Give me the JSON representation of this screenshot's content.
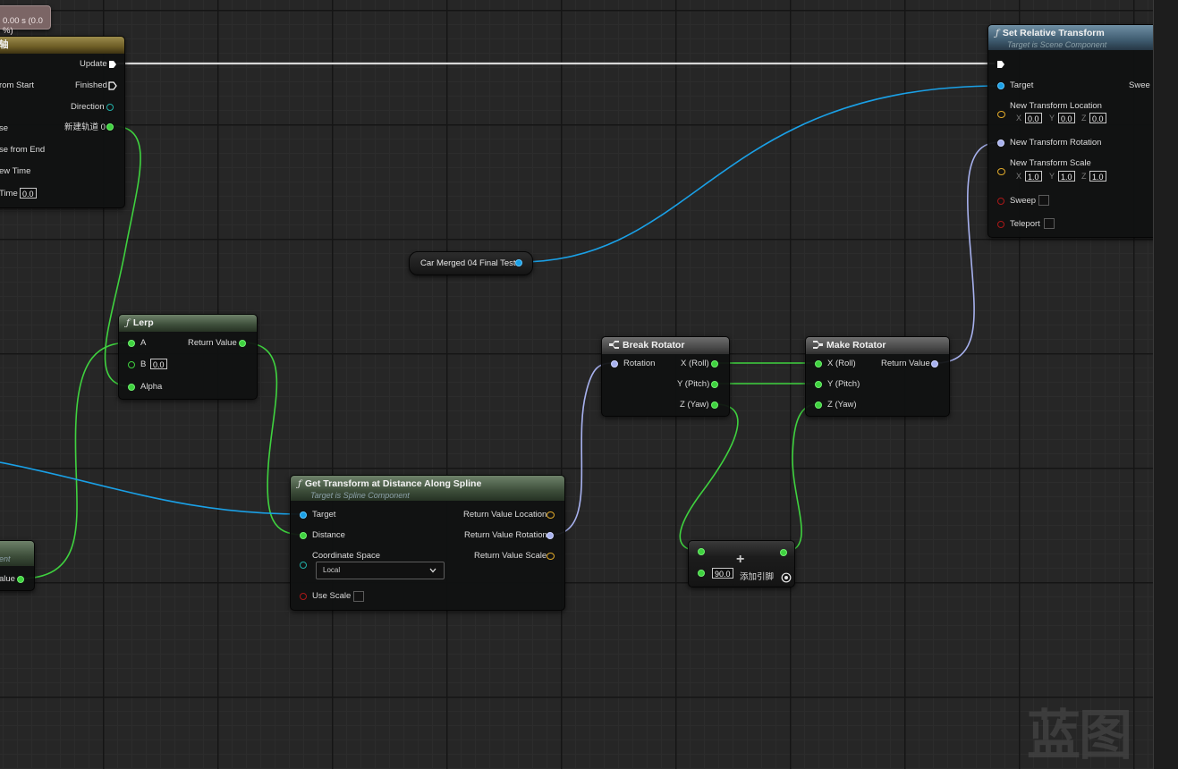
{
  "timeline": {
    "badge": "0.00 s (0.0 %)",
    "header_title": "轴",
    "out_update": "Update",
    "out_finished": "Finished",
    "out_direction": "Direction",
    "out_track": "新建轨道 0",
    "in_play_from_start": "rom Start",
    "in_reverse": "se",
    "in_reverse_from_end": "se from End",
    "in_set_new_time": "ew Time",
    "in_new_time": "Time",
    "new_time_value": "0.0"
  },
  "spline_fragment": {
    "subtitle": "ent",
    "out_return": "alue"
  },
  "lerp": {
    "title": "Lerp",
    "in_a": "A",
    "in_b": "B",
    "b_value": "0.0",
    "in_alpha": "Alpha",
    "out_return": "Return Value"
  },
  "get_transform": {
    "title": "Get Transform at Distance Along Spline",
    "subtitle": "Target is Spline Component",
    "in_target": "Target",
    "in_distance": "Distance",
    "in_coord_space": "Coordinate Space",
    "coord_space_value": "Local",
    "in_use_scale": "Use Scale",
    "out_location": "Return Value Location",
    "out_rotation": "Return Value Rotation",
    "out_scale": "Return Value Scale"
  },
  "car_variable": {
    "label": "Car Merged 04 Final Test"
  },
  "set_relative_transform": {
    "title": "Set Relative Transform",
    "subtitle": "Target is Scene Component",
    "in_target": "Target",
    "out_sweep_hit": "Swee",
    "in_location": "New Transform Location",
    "loc_x": "0.0",
    "loc_y": "0.0",
    "loc_z": "0.0",
    "in_rotation": "New Transform Rotation",
    "in_scale": "New Transform Scale",
    "scale_x": "1.0",
    "scale_y": "1.0",
    "scale_z": "1.0",
    "in_sweep": "Sweep",
    "in_teleport": "Teleport",
    "axis_x": "X",
    "axis_y": "Y",
    "axis_z": "Z"
  },
  "break_rotator": {
    "title": "Break Rotator",
    "in_rotation": "Rotation",
    "out_x": "X (Roll)",
    "out_y": "Y (Pitch)",
    "out_z": "Z (Yaw)"
  },
  "make_rotator": {
    "title": "Make Rotator",
    "in_x": "X (Roll)",
    "in_y": "Y (Pitch)",
    "in_z": "Z (Yaw)",
    "out_return": "Return Value"
  },
  "add_node": {
    "plus": "+",
    "value": "90.0",
    "add_pin": "添加引脚"
  },
  "watermark": "蓝图",
  "colors": {
    "float_pin": "#3fd23f",
    "object_pin": "#1aa0e6",
    "rotator_pin": "#a7b1ee",
    "exec_wire": "#d8d8d8"
  }
}
